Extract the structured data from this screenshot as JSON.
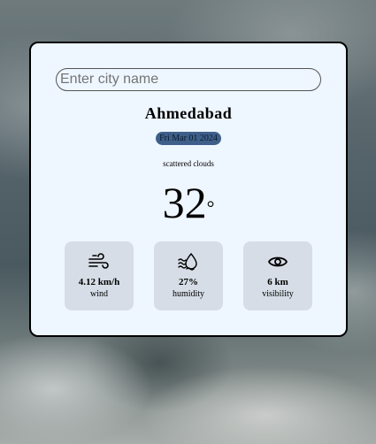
{
  "search": {
    "placeholder": "Enter city name",
    "value": ""
  },
  "city": "Ahmedabad",
  "date": "Fri Mar 01 2024",
  "description": "scattered clouds",
  "temperature": "32",
  "temperature_unit": "°",
  "stats": [
    {
      "icon": "wind-icon",
      "value": "4.12 km/h",
      "label": "wind"
    },
    {
      "icon": "humidity-icon",
      "value": "27%",
      "label": "humidity"
    },
    {
      "icon": "eye-icon",
      "value": "6 km",
      "label": "visibility"
    }
  ],
  "colors": {
    "card_bg": "#eef6ff",
    "date_badge": "#3e5f8a",
    "stat_tile": "#d6dde6"
  }
}
